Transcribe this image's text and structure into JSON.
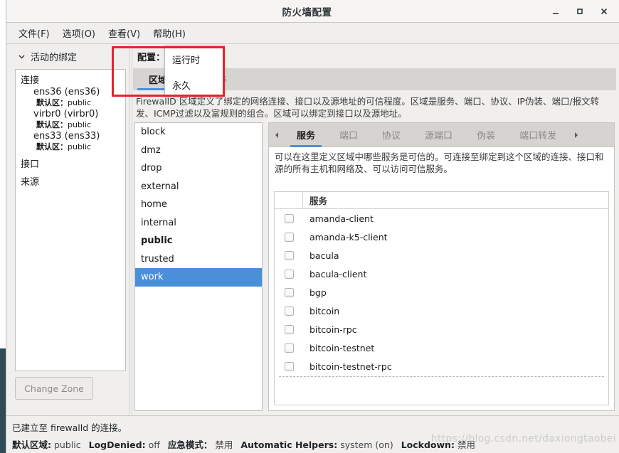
{
  "window": {
    "title": "防火墙配置",
    "minimize_icon": "minimize-icon",
    "maximize_icon": "maximize-icon",
    "close_icon": "close-icon"
  },
  "menubar": {
    "items": [
      {
        "label": "文件(F)"
      },
      {
        "label": "选项(O)"
      },
      {
        "label": "查看(V)"
      },
      {
        "label": "帮助(H)"
      }
    ]
  },
  "left_pane": {
    "header": "活动的绑定",
    "chevron_icon": "chevron-down-icon",
    "groups": [
      {
        "title": "连接",
        "items": [
          {
            "name": "ens36 (ens36)",
            "zone_label": "默认区",
            "zone_sep": "：",
            "zone_value": "public"
          },
          {
            "name": "virbr0 (virbr0)",
            "zone_label": "默认区",
            "zone_sep": "：",
            "zone_value": "public"
          },
          {
            "name": "ens33 (ens33)",
            "zone_label": "默认区",
            "zone_sep": "：",
            "zone_value": "public"
          }
        ]
      },
      {
        "title": "接口",
        "items": []
      },
      {
        "title": "来源",
        "items": []
      }
    ],
    "change_zone_button": "Change Zone"
  },
  "config": {
    "label": "配置：",
    "selected": "运行时",
    "dropdown_options": [
      {
        "label": "运行时"
      },
      {
        "label": "永久"
      }
    ]
  },
  "top_tabs": [
    {
      "label": "区域",
      "active": true
    },
    {
      "label": "IPSets",
      "active": false
    }
  ],
  "zones_description": "FirewallD 区域定义了绑定的网络连接、接口以及源地址的可信程度。区域是服务、端口、协议、IP伪装、端口/报文转发、ICMP过滤以及富规则的组合。区域可以绑定到接口以及源地址。",
  "zone_list": [
    {
      "name": "block",
      "default": false,
      "selected": false
    },
    {
      "name": "dmz",
      "default": false,
      "selected": false
    },
    {
      "name": "drop",
      "default": false,
      "selected": false
    },
    {
      "name": "external",
      "default": false,
      "selected": false
    },
    {
      "name": "home",
      "default": false,
      "selected": false
    },
    {
      "name": "internal",
      "default": false,
      "selected": false
    },
    {
      "name": "public",
      "default": true,
      "selected": false
    },
    {
      "name": "trusted",
      "default": false,
      "selected": false
    },
    {
      "name": "work",
      "default": false,
      "selected": true
    }
  ],
  "detail_tabs": {
    "prev_icon": "chevron-left-icon",
    "next_icon": "chevron-right-icon",
    "items": [
      {
        "label": "服务",
        "active": true
      },
      {
        "label": "端口",
        "active": false
      },
      {
        "label": "协议",
        "active": false
      },
      {
        "label": "源端口",
        "active": false
      },
      {
        "label": "伪装",
        "active": false
      },
      {
        "label": "端口转发",
        "active": false
      }
    ]
  },
  "services_description": "可以在这里定义区域中哪些服务是可信的。可连接至绑定到这个区域的连接、接口和源的所有主机和网络及、可以访问可信服务。",
  "services_table": {
    "column_header": "服务",
    "rows": [
      {
        "name": "amanda-client",
        "checked": false
      },
      {
        "name": "amanda-k5-client",
        "checked": false
      },
      {
        "name": "bacula",
        "checked": false
      },
      {
        "name": "bacula-client",
        "checked": false
      },
      {
        "name": "bgp",
        "checked": false
      },
      {
        "name": "bitcoin",
        "checked": false
      },
      {
        "name": "bitcoin-rpc",
        "checked": false
      },
      {
        "name": "bitcoin-testnet",
        "checked": false
      },
      {
        "name": "bitcoin-testnet-rpc",
        "checked": false
      }
    ]
  },
  "statusbar": {
    "connection_text": "已建立至 firewalld 的连接。",
    "fields": [
      {
        "key": "默认区域:",
        "value": "public"
      },
      {
        "key": "LogDenied:",
        "value": "off"
      },
      {
        "key": "应急模式：",
        "value": "禁用"
      },
      {
        "key": "Automatic Helpers:",
        "value": "system (on)"
      },
      {
        "key": "Lockdown:",
        "value": "禁用"
      }
    ]
  },
  "watermark": "https://blog.csdn.net/daxiongtaobei",
  "annotation": {
    "shape": "rectangle",
    "color": "#e8222a"
  },
  "colors": {
    "accent": "#4a90d9",
    "selection": "#4a90d9",
    "tab_bar": "#d6d4d1",
    "window_bg": "#f0efee",
    "annotation_red": "#e8222a"
  }
}
